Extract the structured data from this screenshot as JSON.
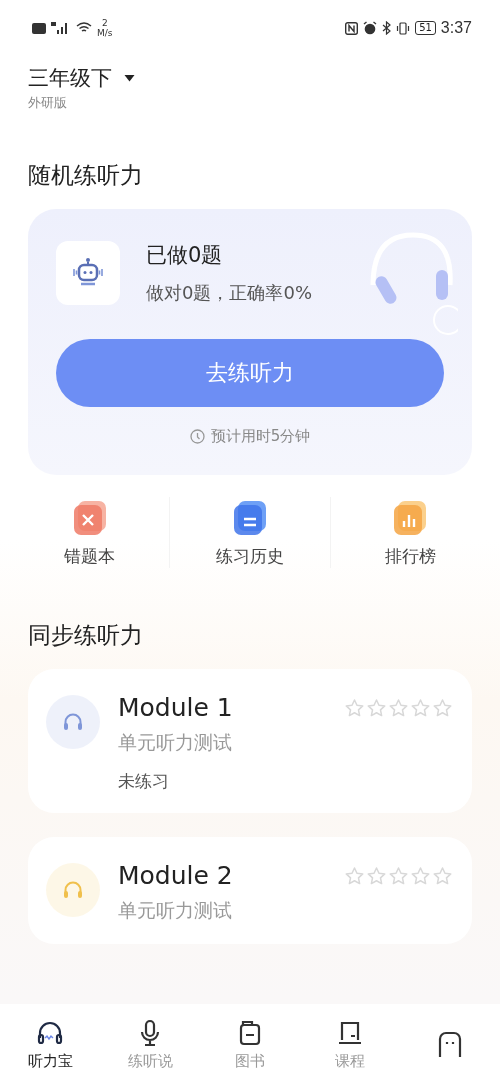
{
  "status_bar": {
    "network_speed_value": "2",
    "network_speed_unit": "M/s",
    "battery": "51",
    "time": "3:37"
  },
  "header": {
    "grade": "三年级下",
    "edition": "外研版"
  },
  "random_section": {
    "title": "随机练听力",
    "done": "已做0题",
    "accuracy": "做对0题，正确率0%",
    "button": "去练听力",
    "estimate": "预计用时5分钟"
  },
  "shortcuts": [
    {
      "kind": "wrong",
      "label": "错题本"
    },
    {
      "kind": "history",
      "label": "练习历史"
    },
    {
      "kind": "rank",
      "label": "排行榜"
    }
  ],
  "sync_section": {
    "title": "同步练听力",
    "modules": [
      {
        "title": "Module 1",
        "subtitle": "单元听力测试",
        "status": "未练习",
        "stars": 0,
        "color": "#7f96d8"
      },
      {
        "title": "Module 2",
        "subtitle": "单元听力测试",
        "stars": 0,
        "color": "#f0c04c"
      }
    ]
  },
  "tabs": [
    {
      "kind": "headphones",
      "label": "听力宝",
      "selected": true
    },
    {
      "kind": "mic",
      "label": "练听说",
      "selected": false
    },
    {
      "kind": "book",
      "label": "图书",
      "selected": false
    },
    {
      "kind": "course",
      "label": "课程",
      "selected": false
    },
    {
      "kind": "face",
      "selected": false
    }
  ]
}
